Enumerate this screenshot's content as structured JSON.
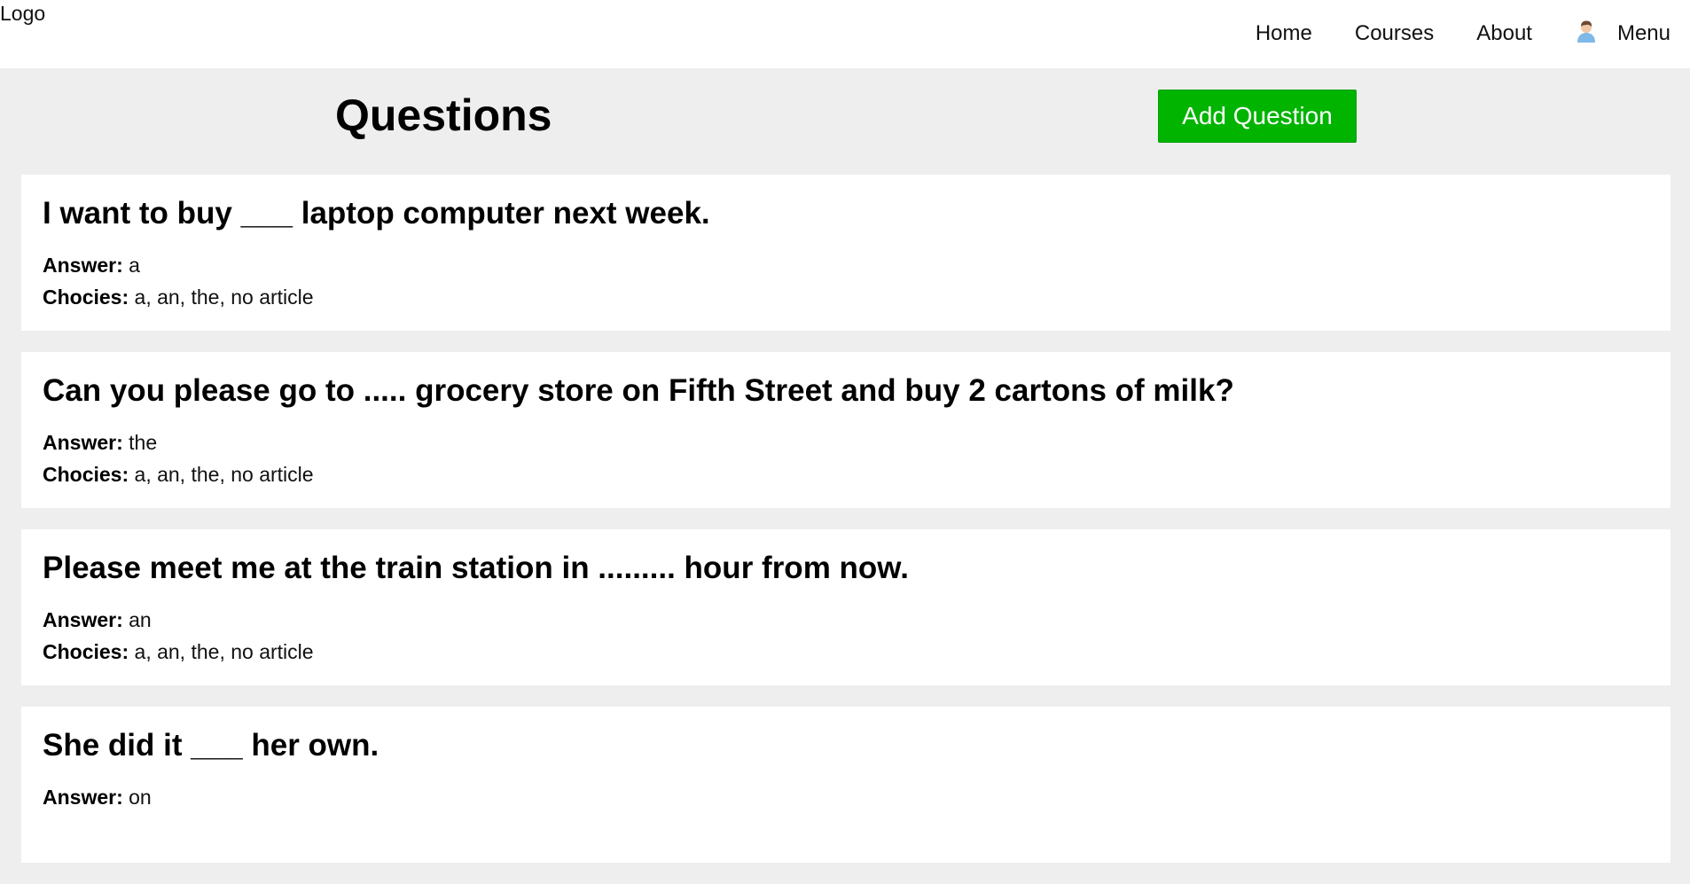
{
  "nav": {
    "logo": "Logo",
    "links": [
      "Home",
      "Courses",
      "About"
    ],
    "menu_label": "Menu"
  },
  "page": {
    "title": "Questions",
    "add_button": "Add Question"
  },
  "labels": {
    "answer": "Answer:",
    "choices": "Chocies:"
  },
  "questions": [
    {
      "text": "I want to buy ___ laptop computer next week.",
      "answer": "a",
      "choices": "a, an, the, no article"
    },
    {
      "text": "Can you please go to ..... grocery store on Fifth Street and buy 2 cartons of milk?",
      "answer": "the",
      "choices": "a, an, the, no article"
    },
    {
      "text": "Please meet me at the train station in ......... hour from now.",
      "answer": "an",
      "choices": "a, an, the, no article"
    },
    {
      "text": "She did it ___ her own.",
      "answer": "on",
      "choices": ""
    }
  ],
  "colors": {
    "accent": "#00b400",
    "background": "#eeeeee",
    "card": "#ffffff"
  },
  "icons": {
    "avatar": "user-avatar-icon"
  }
}
